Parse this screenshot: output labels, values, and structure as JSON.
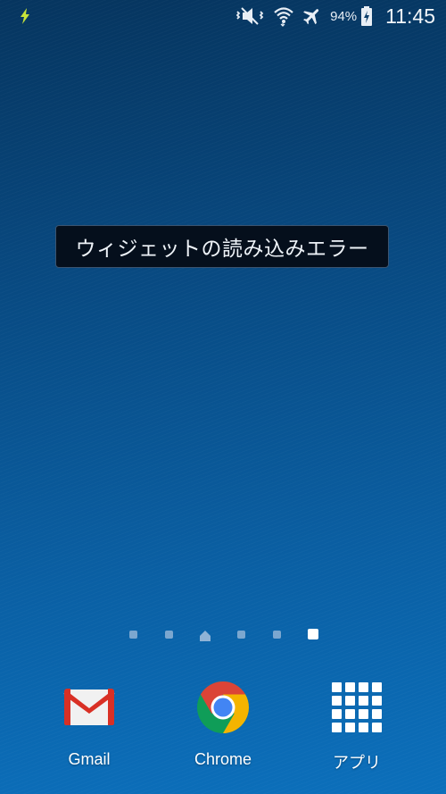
{
  "status_bar": {
    "left_icon": "lightning-bolt-icon",
    "icons": [
      "vibrate-muted-icon",
      "wifi-icon",
      "airplane-mode-icon"
    ],
    "battery_percent": "94%",
    "battery_icon": "battery-charging-icon",
    "time": "11:45"
  },
  "widget": {
    "error_text": "ウィジェットの読み込みエラー"
  },
  "page_indicator": {
    "pages": 6,
    "home_page_index": 2,
    "active_page_index": 5
  },
  "dock": {
    "apps": [
      {
        "label": "Gmail",
        "icon": "gmail-icon"
      },
      {
        "label": "Chrome",
        "icon": "chrome-icon"
      },
      {
        "label": "アプリ",
        "icon": "apps-grid-icon"
      }
    ]
  },
  "colors": {
    "accent_bolt": "#c6e23a",
    "gmail_red": "#d93025",
    "chrome_red": "#db4437",
    "chrome_green": "#0f9d58",
    "chrome_yellow": "#f4b400",
    "chrome_blue": "#4285f4"
  }
}
